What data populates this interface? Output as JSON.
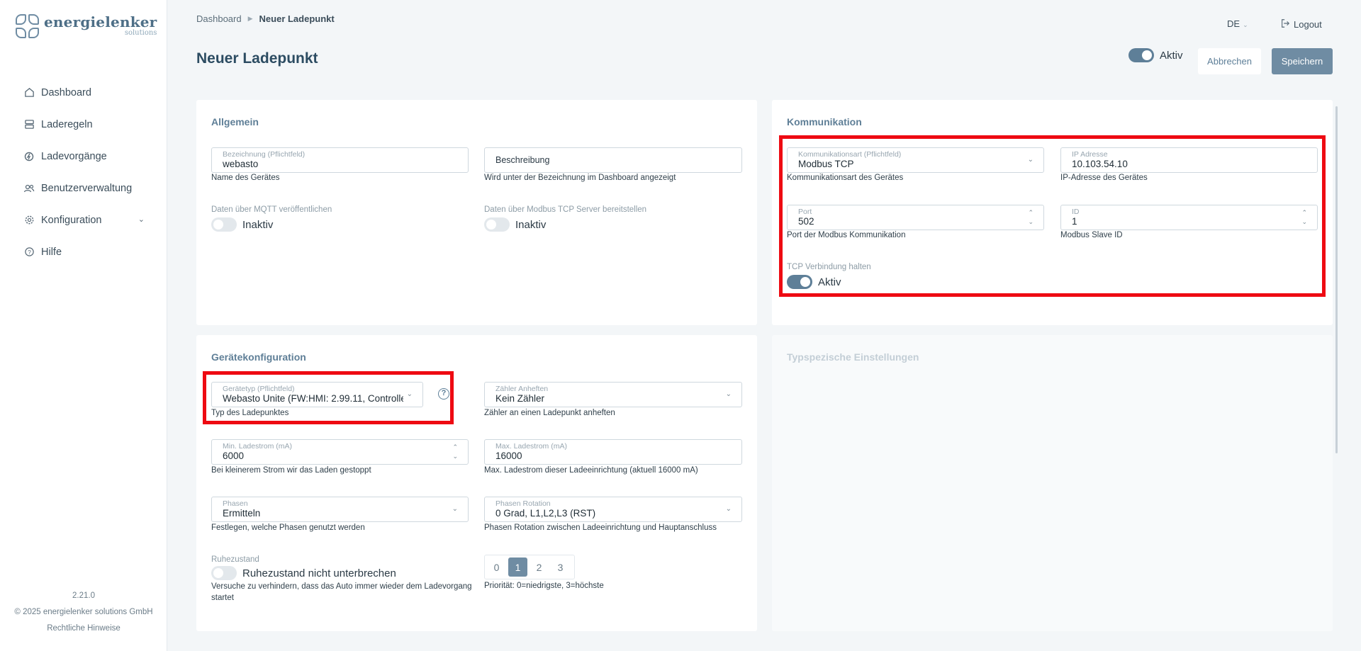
{
  "brand": {
    "name": "energielenker",
    "sub": "solutions"
  },
  "nav": {
    "items": [
      {
        "label": "Dashboard",
        "icon": "home-icon"
      },
      {
        "label": "Laderegeln",
        "icon": "rules-icon"
      },
      {
        "label": "Ladevorgänge",
        "icon": "charging-sessions-icon"
      },
      {
        "label": "Benutzerverwaltung",
        "icon": "users-icon"
      },
      {
        "label": "Konfiguration",
        "icon": "gear-icon"
      },
      {
        "label": "Hilfe",
        "icon": "help-icon"
      }
    ]
  },
  "footer": {
    "version": "2.21.0",
    "copyright": "© 2025 energielenker solutions GmbH",
    "legal": "Rechtliche Hinweise"
  },
  "breadcrumb": {
    "root": "Dashboard",
    "current": "Neuer Ladepunkt"
  },
  "header": {
    "language": "DE",
    "logout": "Logout"
  },
  "page": {
    "title": "Neuer Ladepunkt",
    "active_label": "Aktiv",
    "cancel": "Abbrechen",
    "save": "Speichern"
  },
  "allgemein": {
    "title": "Allgemein",
    "name_label": "Bezeichnung (Pflichtfeld)",
    "name_value": "webasto",
    "name_hint": "Name des Gerätes",
    "desc_placeholder": "Beschreibung",
    "desc_hint": "Wird unter der Bezeichnung im Dashboard angezeigt",
    "mqtt_label": "Daten über MQTT veröffentlichen",
    "mqtt_state": "Inaktiv",
    "modbus_label": "Daten über Modbus TCP Server bereitstellen",
    "modbus_state": "Inaktiv"
  },
  "kommunikation": {
    "title": "Kommunikation",
    "type_label": "Kommunikationsart (Pflichtfeld)",
    "type_value": "Modbus TCP",
    "type_hint": "Kommunikationsart des Gerätes",
    "ip_label": "IP Adresse",
    "ip_value": "10.103.54.10",
    "ip_hint": "IP-Adresse des Gerätes",
    "port_label": "Port",
    "port_value": "502",
    "port_hint": "Port der Modbus Kommunikation",
    "id_label": "ID",
    "id_value": "1",
    "id_hint": "Modbus Slave ID",
    "tcp_label": "TCP Verbindung halten",
    "tcp_state": "Aktiv"
  },
  "geraet": {
    "title": "Gerätekonfiguration",
    "type_label": "Gerätetyp (Pflichtfeld)",
    "type_value": "Webasto Unite (FW:HMI: 2.99.11, Controlle...",
    "type_hint": "Typ des Ladepunktes",
    "meter_label": "Zähler Anheften",
    "meter_value": "Kein Zähler",
    "meter_hint": "Zähler an einen Ladepunkt anheften",
    "min_label": "Min. Ladestrom (mA)",
    "min_value": "6000",
    "min_hint": "Bei kleinerem Strom wir das Laden gestoppt",
    "max_label": "Max. Ladestrom (mA)",
    "max_value": "16000",
    "max_hint": "Max. Ladestrom dieser Ladeeinrichtung (aktuell 16000 mA)",
    "phase_label": "Phasen",
    "phase_value": "Ermitteln",
    "phase_hint": "Festlegen, welche Phasen genutzt werden",
    "rot_label": "Phasen Rotation",
    "rot_value": "0 Grad, L1,L2,L3 (RST)",
    "rot_hint": "Phasen Rotation zwischen Ladeeinrichtung und Hauptanschluss",
    "idle_label": "Ruhezustand",
    "idle_state": "Ruhezustand nicht unterbrechen",
    "idle_hint_1": "Versuche zu verhindern, dass das Auto immer wieder dem Ladevorgang",
    "idle_hint_2": "startet",
    "prio_options": [
      "0",
      "1",
      "2",
      "3"
    ],
    "prio_hint": "Priorität: 0=niedrigste, 3=höchste"
  },
  "typ": {
    "title": "Typspezische Einstellungen"
  }
}
